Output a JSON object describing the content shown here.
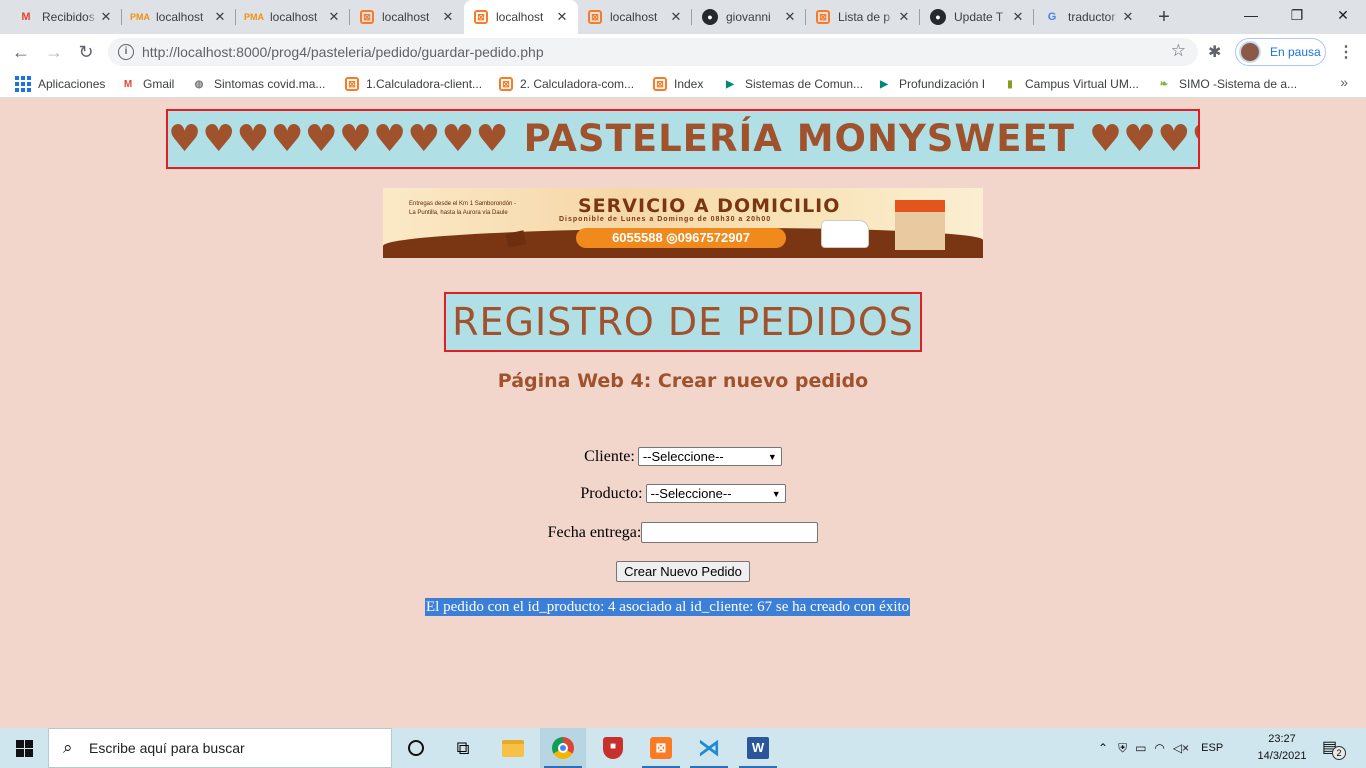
{
  "browser": {
    "tabs": [
      {
        "title": "Recibidos",
        "icon": "gmail-icon",
        "glyph": "M"
      },
      {
        "title": "localhost",
        "icon": "phpmyadmin-icon",
        "glyph": "PMA"
      },
      {
        "title": "localhost",
        "icon": "phpmyadmin-icon",
        "glyph": "PMA"
      },
      {
        "title": "localhost",
        "icon": "xampp-icon",
        "glyph": "⊠"
      },
      {
        "title": "localhost",
        "icon": "xampp-icon",
        "glyph": "⊠"
      },
      {
        "title": "localhost",
        "icon": "xampp-icon",
        "glyph": "⊠"
      },
      {
        "title": "giovanni",
        "icon": "github-icon",
        "glyph": "●"
      },
      {
        "title": "Lista de p",
        "icon": "xampp-icon",
        "glyph": "⊠"
      },
      {
        "title": "Update T",
        "icon": "github-icon",
        "glyph": "●"
      },
      {
        "title": "traductor",
        "icon": "google-icon",
        "glyph": "G"
      }
    ],
    "new_tab_glyph": "+",
    "url": "http://localhost:8000/prog4/pasteleria/pedido/guardar-pedido.php",
    "profile_status": "En pausa",
    "bookmarks": [
      {
        "label": "Aplicaciones",
        "icon": "apps-icon"
      },
      {
        "label": "Gmail",
        "icon": "gmail-icon",
        "glyph": "M"
      },
      {
        "label": "Sintomas covid.ma...",
        "icon": "site-icon",
        "glyph": "◍"
      },
      {
        "label": "1.Calculadora-client...",
        "icon": "xampp-icon",
        "glyph": "⊠"
      },
      {
        "label": "2. Calculadora-com...",
        "icon": "xampp-icon",
        "glyph": "⊠"
      },
      {
        "label": "Index",
        "icon": "xampp-icon",
        "glyph": "⊠"
      },
      {
        "label": "Sistemas de Comun...",
        "icon": "meet-icon",
        "glyph": "▶"
      },
      {
        "label": "Profundización I",
        "icon": "meet-icon",
        "glyph": "▶"
      },
      {
        "label": "Campus Virtual UM...",
        "icon": "campus-icon",
        "glyph": "▮"
      },
      {
        "label": "SIMO -Sistema de a...",
        "icon": "leaf-icon",
        "glyph": "❧"
      }
    ]
  },
  "page": {
    "banner_title": "♥♥♥♥♥♥♥♥♥♥ PASTELERÍA MONYSWEET ♥♥♥♥♥♥♥♥♥",
    "promo": {
      "small_text": "Entregas desde el Km 1 Samborondón - La Puntilla, hasta la Aurora vía Daule",
      "title": "SERVICIO A DOMICILIO",
      "subtitle": "Disponible de Lunes a Domingo de 08h30 a 20h00",
      "phones": "6055588 ◎0967572907"
    },
    "heading": "REGISTRO DE PEDIDOS",
    "subheading": "Página Web 4: Crear nuevo pedido",
    "form": {
      "cliente_label": "Cliente:",
      "cliente_value": "--Seleccione--",
      "producto_label": "Producto:",
      "producto_value": "--Seleccione--",
      "fecha_label": "Fecha entrega:",
      "fecha_value": "",
      "submit_label": "Crear Nuevo Pedido"
    },
    "result_message": "El pedido con el id_producto: 4 asociado al id_cliente: 67 se ha creado con éxito"
  },
  "taskbar": {
    "search_placeholder": "Escribe aquí para buscar",
    "language": "ESP",
    "time": "23:27",
    "date": "14/3/2021",
    "notification_count": "2"
  }
}
